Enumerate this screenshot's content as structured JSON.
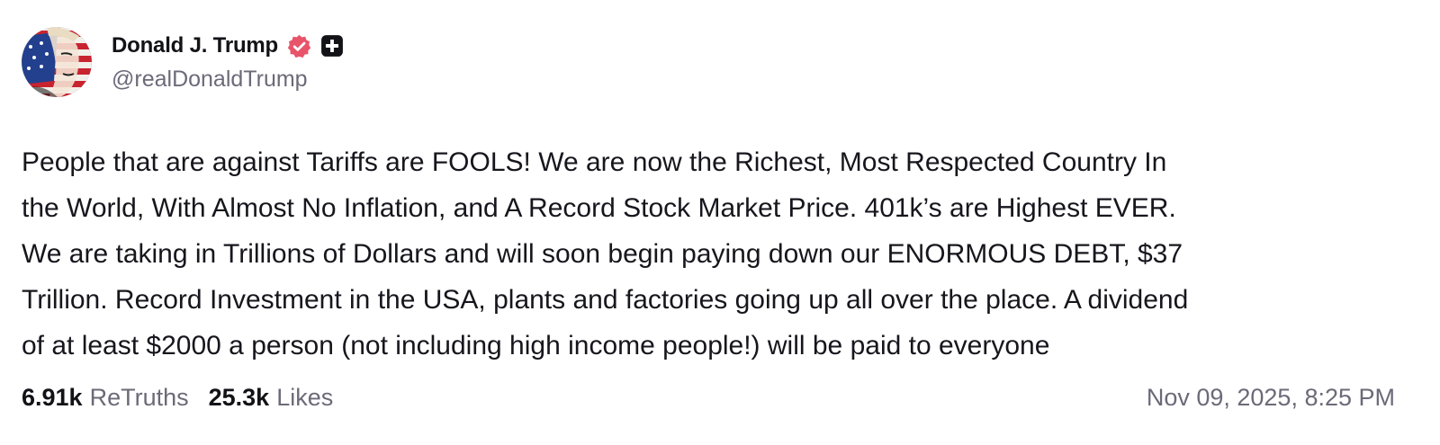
{
  "author": {
    "display_name": "Donald J. Trump",
    "handle": "@realDonaldTrump",
    "verified_icon": "verified-badge-icon",
    "plus_icon": "truth-plus-icon",
    "accent_color": "#e8546a"
  },
  "post": {
    "lines": [
      "People that are against Tariffs are FOOLS! We are now the Richest, Most Respected Country In",
      "the World, With Almost No Inflation, and A Record Stock Market Price. 401k’s are Highest EVER.",
      "We are taking in Trillions of Dollars and will soon begin paying down our ENORMOUS DEBT, $37",
      "Trillion. Record Investment in the USA, plants and factories going up all over the place. A dividend",
      "of at least $2000 a person (not including high income people!) will be paid to everyone"
    ]
  },
  "stats": {
    "retruths_count": "6.91k",
    "retruths_label": "ReTruths",
    "likes_count": "25.3k",
    "likes_label": "Likes"
  },
  "timestamp": "Nov 09, 2025, 8:25 PM"
}
